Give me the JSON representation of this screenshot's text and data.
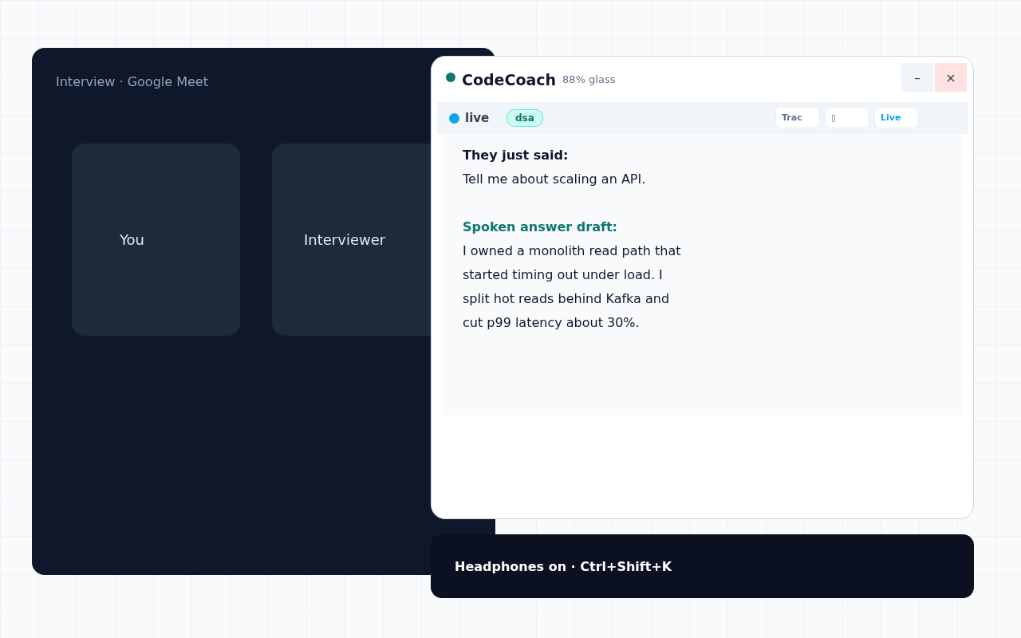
{
  "meet_window": {
    "title": "Interview · Google Meet",
    "tiles": [
      {
        "label": "You"
      },
      {
        "label": "Interviewer"
      }
    ]
  },
  "overlay": {
    "title": "CodeCoach",
    "opacity_label": "88% glass",
    "window_buttons": [
      {
        "kind": "minimize",
        "label": "–"
      },
      {
        "kind": "close",
        "label": "×"
      }
    ],
    "status": {
      "label": "live",
      "color": "#0ea5e9"
    },
    "tag": "dsa",
    "toolbar_buttons": [
      {
        "label": "Trac",
        "kind": "plain"
      },
      {
        "label": "▯",
        "kind": "plain"
      },
      {
        "label": "Live",
        "kind": "accent"
      }
    ],
    "sections": [
      {
        "heading": "They just said:",
        "kind": "quote",
        "body": "Tell me about scaling an API."
      },
      {
        "heading": "Spoken answer draft:",
        "kind": "answer",
        "body": "I owned a monolith read path that started timing out under load. I split hot reads behind Kafka and cut p99 latency about 30%."
      }
    ]
  },
  "hint_bar": {
    "text": "Headphones on · Ctrl+Shift+K"
  }
}
